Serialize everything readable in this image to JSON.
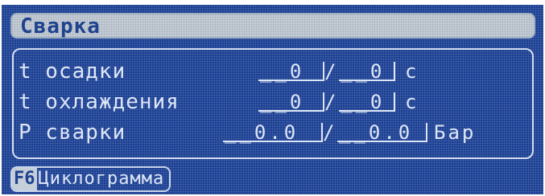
{
  "header": {
    "title": "Сварка"
  },
  "params": [
    {
      "label": "t осадки",
      "actual": "__0",
      "setpoint": "__0",
      "unit": "с"
    },
    {
      "label": "t охлаждения",
      "actual": "__0",
      "setpoint": "__0",
      "unit": "с"
    },
    {
      "label": "Р сварки",
      "actual": "__0.0",
      "setpoint": "__0.0",
      "unit": "Бар"
    }
  ],
  "separator": "/",
  "footer": {
    "fkey": "F6",
    "label": "Циклограмма"
  }
}
